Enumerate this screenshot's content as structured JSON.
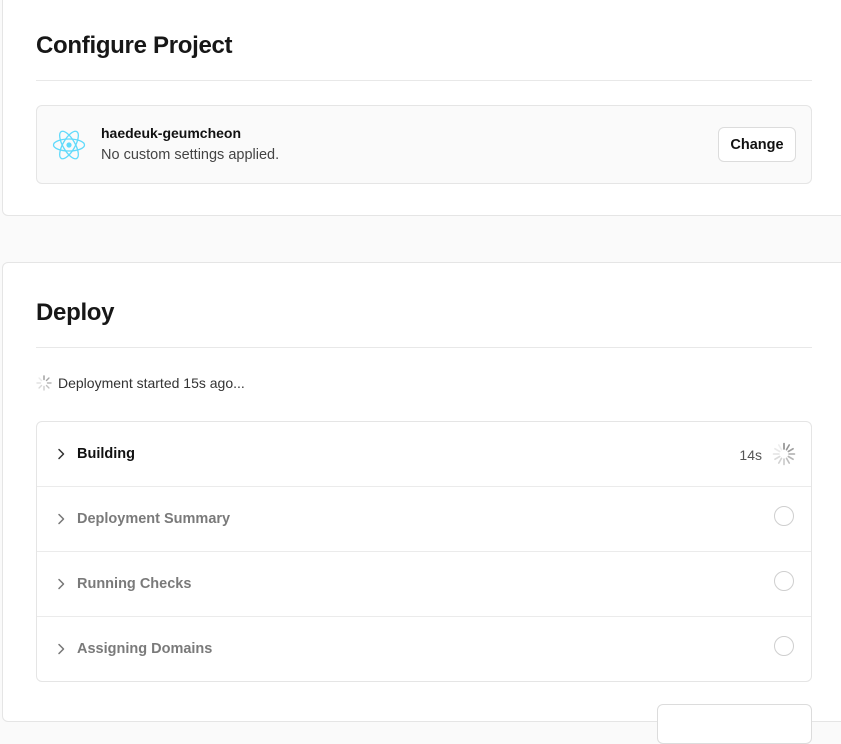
{
  "configure": {
    "title": "Configure Project",
    "project": {
      "name": "haedeuk-geumcheon",
      "subtitle": "No custom settings applied.",
      "icon": "react-icon",
      "change_label": "Change"
    }
  },
  "deploy": {
    "title": "Deploy",
    "status_text": "Deployment started 15s ago...",
    "steps": [
      {
        "label": "Building",
        "time": "14s",
        "state": "in-progress"
      },
      {
        "label": "Deployment Summary",
        "state": "pending"
      },
      {
        "label": "Running Checks",
        "state": "pending"
      },
      {
        "label": "Assigning Domains",
        "state": "pending"
      }
    ]
  },
  "colors": {
    "react_blue": "#61dafb",
    "text_primary": "#171717",
    "text_muted": "#7a7a7a",
    "border": "#e5e5e5"
  }
}
